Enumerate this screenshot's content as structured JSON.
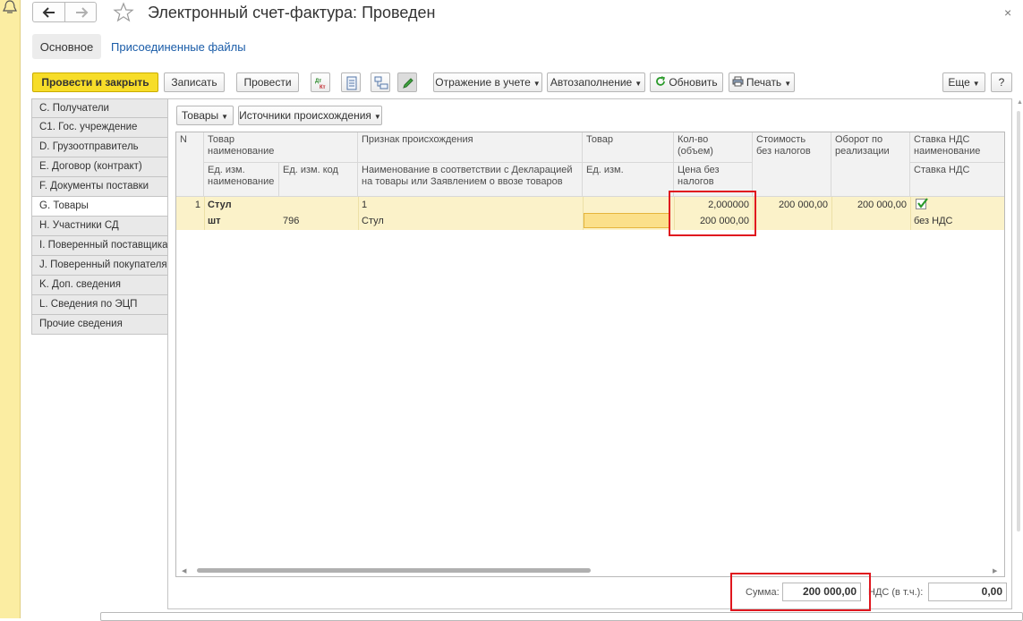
{
  "window": {
    "title": "Электронный счет-фактура: Проведен"
  },
  "tabs": {
    "main": "Основное",
    "files": "Присоединенные файлы"
  },
  "toolbar": {
    "post_close": "Провести и закрыть",
    "save": "Записать",
    "post": "Провести",
    "reflect": "Отражение в учете",
    "autofill": "Автозаполнение",
    "refresh": "Обновить",
    "print": "Печать",
    "more": "Еще",
    "help": "?"
  },
  "sidebar": {
    "items": [
      "C. Получатели",
      "C1. Гос. учреждение",
      "D. Грузоотправитель",
      "E. Договор (контракт)",
      "F. Документы поставки",
      "G. Товары",
      "H. Участники СД",
      "I. Поверенный поставщика",
      "J. Поверенный покупателя",
      "K. Доп. сведения",
      "L. Сведения по ЭЦП",
      "Прочие сведения"
    ],
    "active_index": 5
  },
  "subtoolbar": {
    "goods": "Товары",
    "origins": "Источники происхождения"
  },
  "grid": {
    "headers": {
      "n": "N",
      "goods_name": "Товар\nнаименование",
      "origin_sign": "Признак происхождения",
      "goods": "Товар",
      "qty": "Кол-во\n(объем)",
      "cost_no_tax": "Стоимость\nбез налогов",
      "turnover": "Оборот по\nреализации",
      "vat_rate_name": "Ставка НДС\nнаименование",
      "unit_name": "Ед. изм.\nнаименование",
      "unit_code": "Ед. изм. код",
      "declaration_name": "Наименование в соответствии с Декларацией\nна товары или Заявлением о ввозе товаров",
      "unit": "Ед. изм.",
      "price_no_tax": "Цена без\nналогов",
      "vat_rate": "Ставка НДС"
    },
    "row": {
      "n": "1",
      "goods_name": "Стул",
      "origin_sign": "1",
      "qty": "2,000000",
      "cost_no_tax": "200 000,00",
      "turnover": "200 000,00",
      "vat_checked": true,
      "unit_name": "шт",
      "unit_code": "796",
      "declaration_name": "Стул",
      "price_no_tax": "200 000,00",
      "vat_rate": "без НДС"
    }
  },
  "totals": {
    "sum_label": "Сумма:",
    "sum_value": "200 000,00",
    "vat_label": "НДС (в т.ч.):",
    "vat_value": "0,00"
  },
  "colors": {
    "accent": "#f7dd29",
    "row_highlight": "#fbf2c9",
    "annotation": "#e0161e",
    "link": "#1a5ca8"
  }
}
